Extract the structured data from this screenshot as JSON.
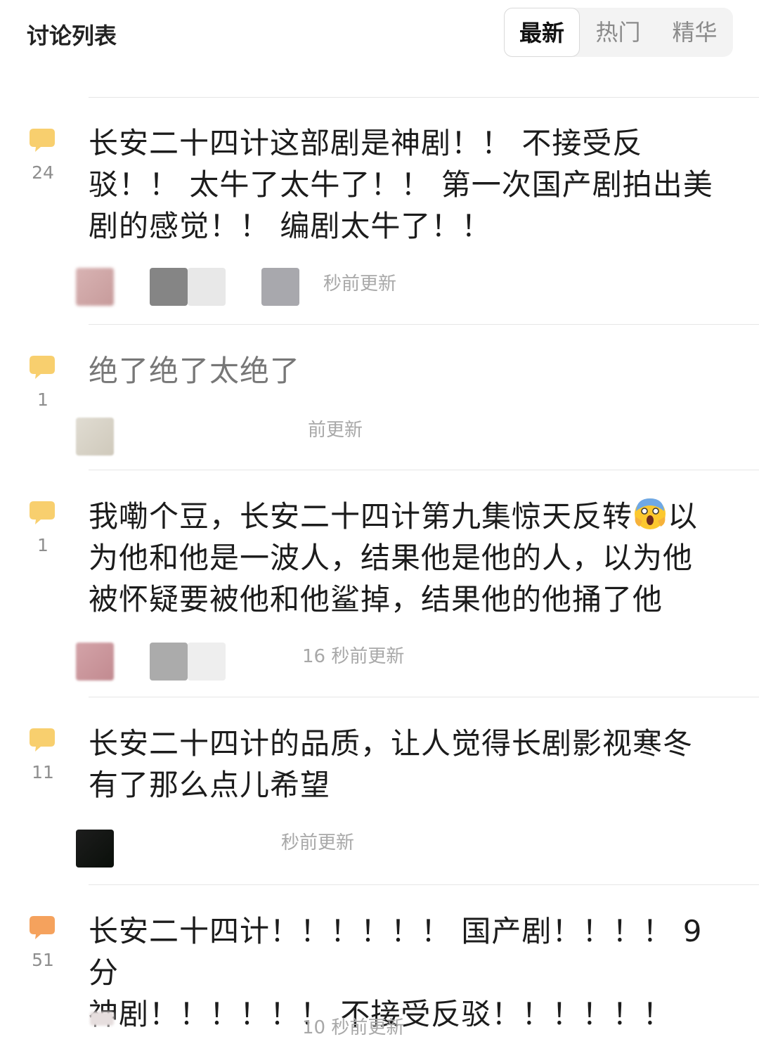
{
  "header": {
    "title": "讨论列表",
    "tabs": [
      {
        "label": "最新",
        "active": true
      },
      {
        "label": "热门",
        "active": false
      },
      {
        "label": "精华",
        "active": false
      }
    ]
  },
  "colors": {
    "icon_yellow": "#f8cf6e",
    "icon_orange": "#f5a25d",
    "active_tab_text": "#111111",
    "muted": "#8e8e8e"
  },
  "threads": [
    {
      "count": "24",
      "lines": [
        "长安二十四计这部剧是神剧！！ 不接受反",
        "驳！！ 太牛了太牛了！！ 第一次国产剧拍出美",
        "剧的感觉！！ 编剧太牛了！！"
      ],
      "update": "秒前更新",
      "icon": "speech-bubble-icon"
    },
    {
      "count": "1",
      "lines": [
        "绝了绝了太绝了"
      ],
      "update": "前更新",
      "icon": "speech-bubble-icon"
    },
    {
      "count": "1",
      "line1_before_emoji": "我嘞个豆，长安二十四计第九集惊天反转",
      "line1_after_emoji": "以",
      "lines": [
        "为他和他是一波人，结果他是他的人，以为他",
        "被怀疑要被他和他鲨掉，结果他的他捅了他"
      ],
      "emoji": "screaming-face-emoji",
      "update": "16 秒前更新",
      "icon": "speech-bubble-icon"
    },
    {
      "count": "11",
      "lines": [
        "长安二十四计的品质，让人觉得长剧影视寒冬",
        "有了那么点儿希望"
      ],
      "update": "秒前更新",
      "icon": "speech-bubble-icon"
    },
    {
      "count": "51",
      "lines": [
        "长安二十四计！！！！！！ 国产剧！！！！ 9分",
        "神剧！！！！！！ 不接受反驳！！！！！！"
      ],
      "update": "10 秒前更新",
      "icon": "hot-speech-bubble-icon"
    }
  ]
}
